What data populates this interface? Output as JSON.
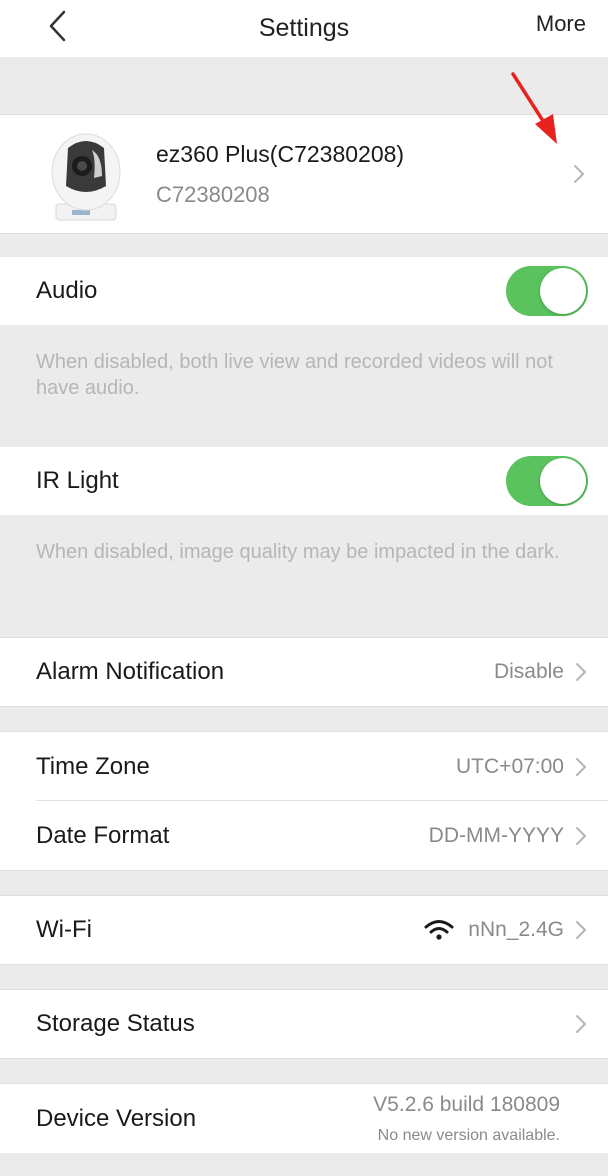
{
  "nav": {
    "title": "Settings",
    "more_label": "More"
  },
  "device": {
    "name": "ez360 Plus(C72380208)",
    "serial": "C72380208"
  },
  "audio": {
    "label": "Audio",
    "enabled": true,
    "hint": "When disabled, both live view and recorded videos will not have audio."
  },
  "ir_light": {
    "label": "IR Light",
    "enabled": true,
    "hint": "When disabled, image quality may be impacted in the dark."
  },
  "alarm": {
    "label": "Alarm Notification",
    "value": "Disable"
  },
  "time_zone": {
    "label": "Time Zone",
    "value": "UTC+07:00"
  },
  "date_format": {
    "label": "Date Format",
    "value": "DD-MM-YYYY"
  },
  "wifi": {
    "label": "Wi-Fi",
    "value": "nNn_2.4G"
  },
  "storage": {
    "label": "Storage Status"
  },
  "version": {
    "label": "Device Version",
    "value": "V5.2.6 build 180809",
    "status": "No new version available."
  },
  "colors": {
    "accent_green": "#5bc35e",
    "annotation_red": "#e8231f"
  },
  "icons": {
    "back": "chevron-left-icon",
    "disclosure": "chevron-right-icon",
    "wifi": "wifi-icon"
  }
}
